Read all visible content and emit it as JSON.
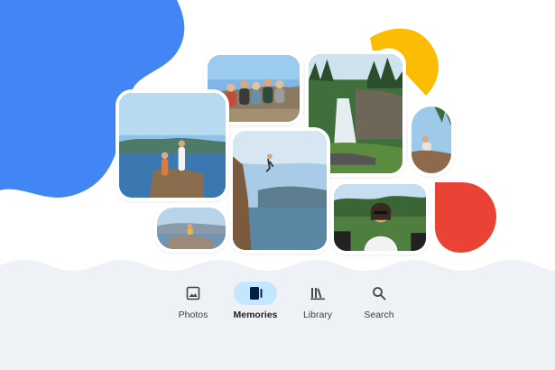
{
  "nav": {
    "items": [
      {
        "label": "Photos",
        "icon": "photo-icon",
        "active": false
      },
      {
        "label": "Memories",
        "icon": "memories-icon",
        "active": true
      },
      {
        "label": "Library",
        "icon": "library-icon",
        "active": false
      },
      {
        "label": "Search",
        "icon": "search-icon",
        "active": false
      }
    ]
  },
  "colors": {
    "brand_blue": "#4285f4",
    "brand_yellow": "#fbbc04",
    "brand_red": "#ea4335",
    "nav_background": "#eef1f6",
    "active_pill": "#c2e7ff"
  },
  "photos": [
    "group-on-rocks-photo",
    "waterfall-photo",
    "couple-at-lake-photo",
    "cliff-jump-photo",
    "person-sitting-photo",
    "woman-smiling-photo",
    "person-on-rock-photo"
  ]
}
